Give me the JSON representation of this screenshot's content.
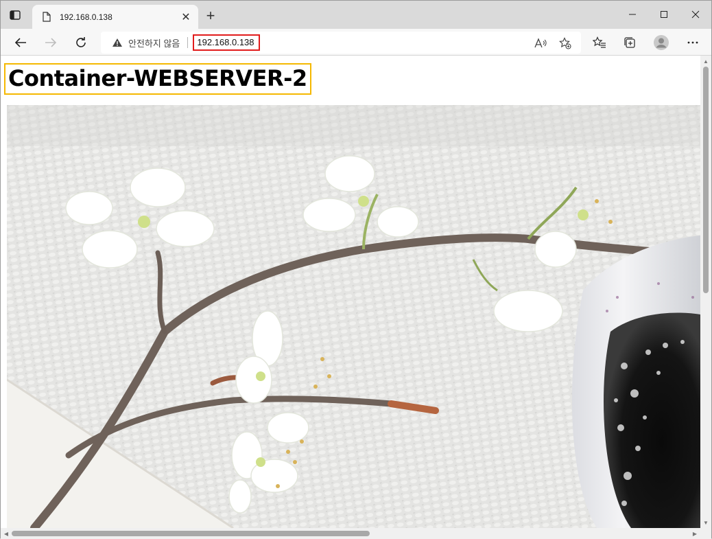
{
  "browser": {
    "tab": {
      "title": "192.168.0.138",
      "close_glyph": "✕"
    },
    "new_tab_glyph": "+",
    "window_controls": {
      "minimize": "—",
      "maximize": "☐",
      "close": "✕"
    },
    "address": {
      "security_label": "안전하지 않음",
      "url": "192.168.0.138"
    },
    "icons": [
      "tab-actions-icon",
      "page-icon",
      "back-icon",
      "forward-icon",
      "refresh-icon",
      "warning-icon",
      "read-aloud-icon",
      "add-favorite-icon",
      "favorites-icon",
      "collections-icon",
      "profile-icon",
      "more-icon"
    ]
  },
  "page": {
    "heading": "Container-WEBSERVER-2",
    "image_description_icon": "photo"
  },
  "colors": {
    "url_highlight": "#e11b1b",
    "heading_highlight": "#f5b800"
  }
}
